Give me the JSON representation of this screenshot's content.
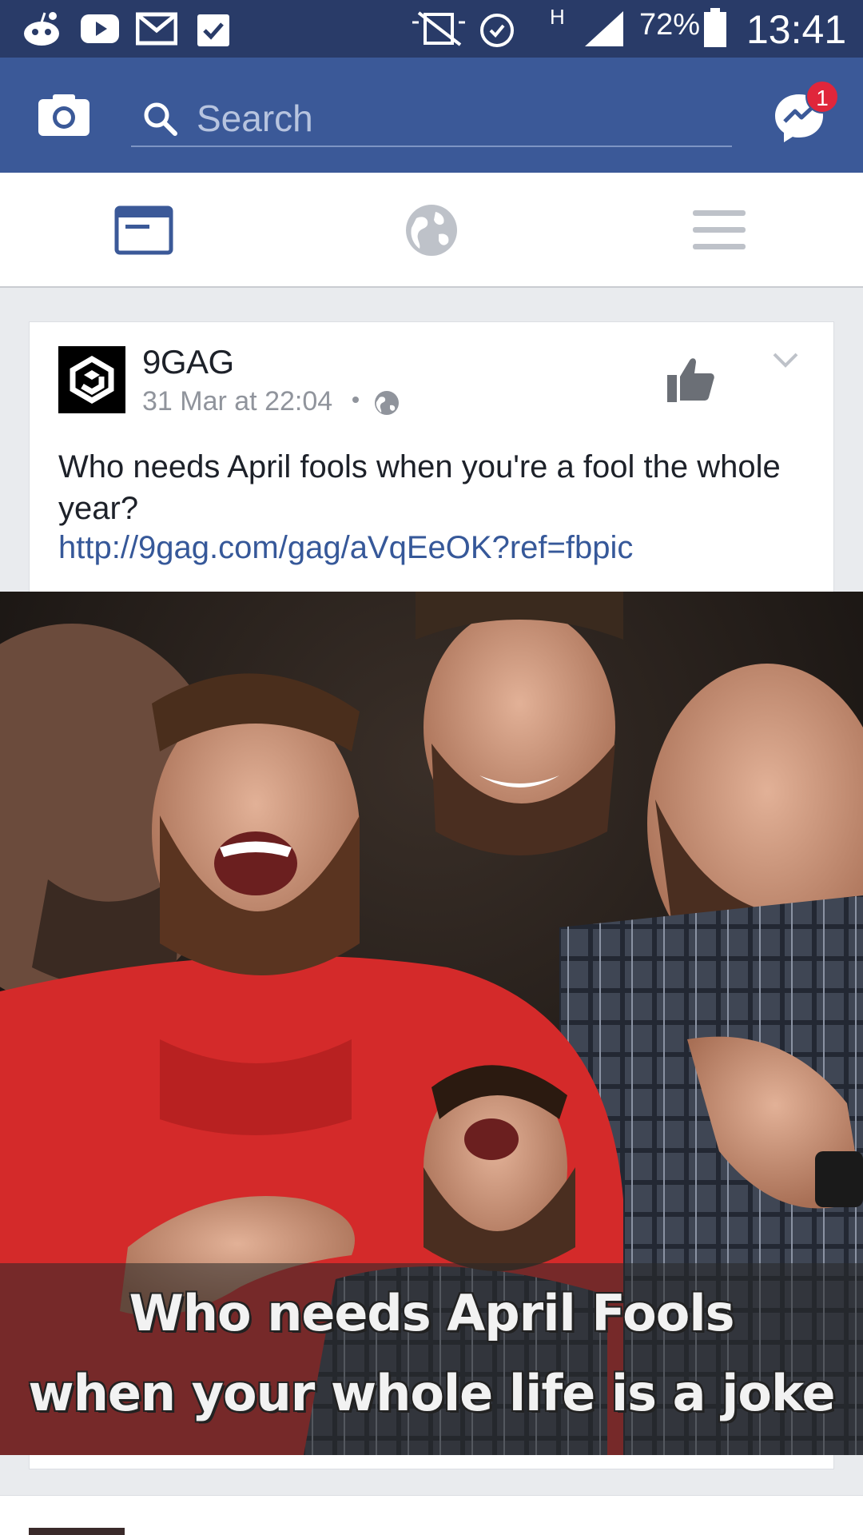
{
  "status_bar": {
    "battery_percent": "72%",
    "time": "13:41",
    "network_type": "H",
    "icons": [
      "reddit-icon",
      "youtube-icon",
      "gmail-icon",
      "clipboard-icon",
      "mute-icon",
      "alarm-icon",
      "signal-icon",
      "battery-icon"
    ]
  },
  "top_bar": {
    "search_placeholder": "Search",
    "messenger_badge": "1",
    "colors": {
      "bar": "#3b5998",
      "badge": "#e0263b"
    }
  },
  "tabs": [
    {
      "name": "news-feed",
      "icon": "feed-icon",
      "active": true
    },
    {
      "name": "notifications",
      "icon": "globe-icon",
      "active": false
    },
    {
      "name": "menu",
      "icon": "hamburger-icon",
      "active": false
    }
  ],
  "post": {
    "page_name": "9GAG",
    "timestamp": "31 Mar at 22:04",
    "privacy_icon": "globe-icon",
    "text": "Who needs April fools when you're a fool the whole year?",
    "link": "http://9gag.com/gag/aVqEeOK?ref=fbpic",
    "image": {
      "caption_line1": "Who needs April Fools",
      "caption_line2": "when your whole life is a joke"
    }
  }
}
